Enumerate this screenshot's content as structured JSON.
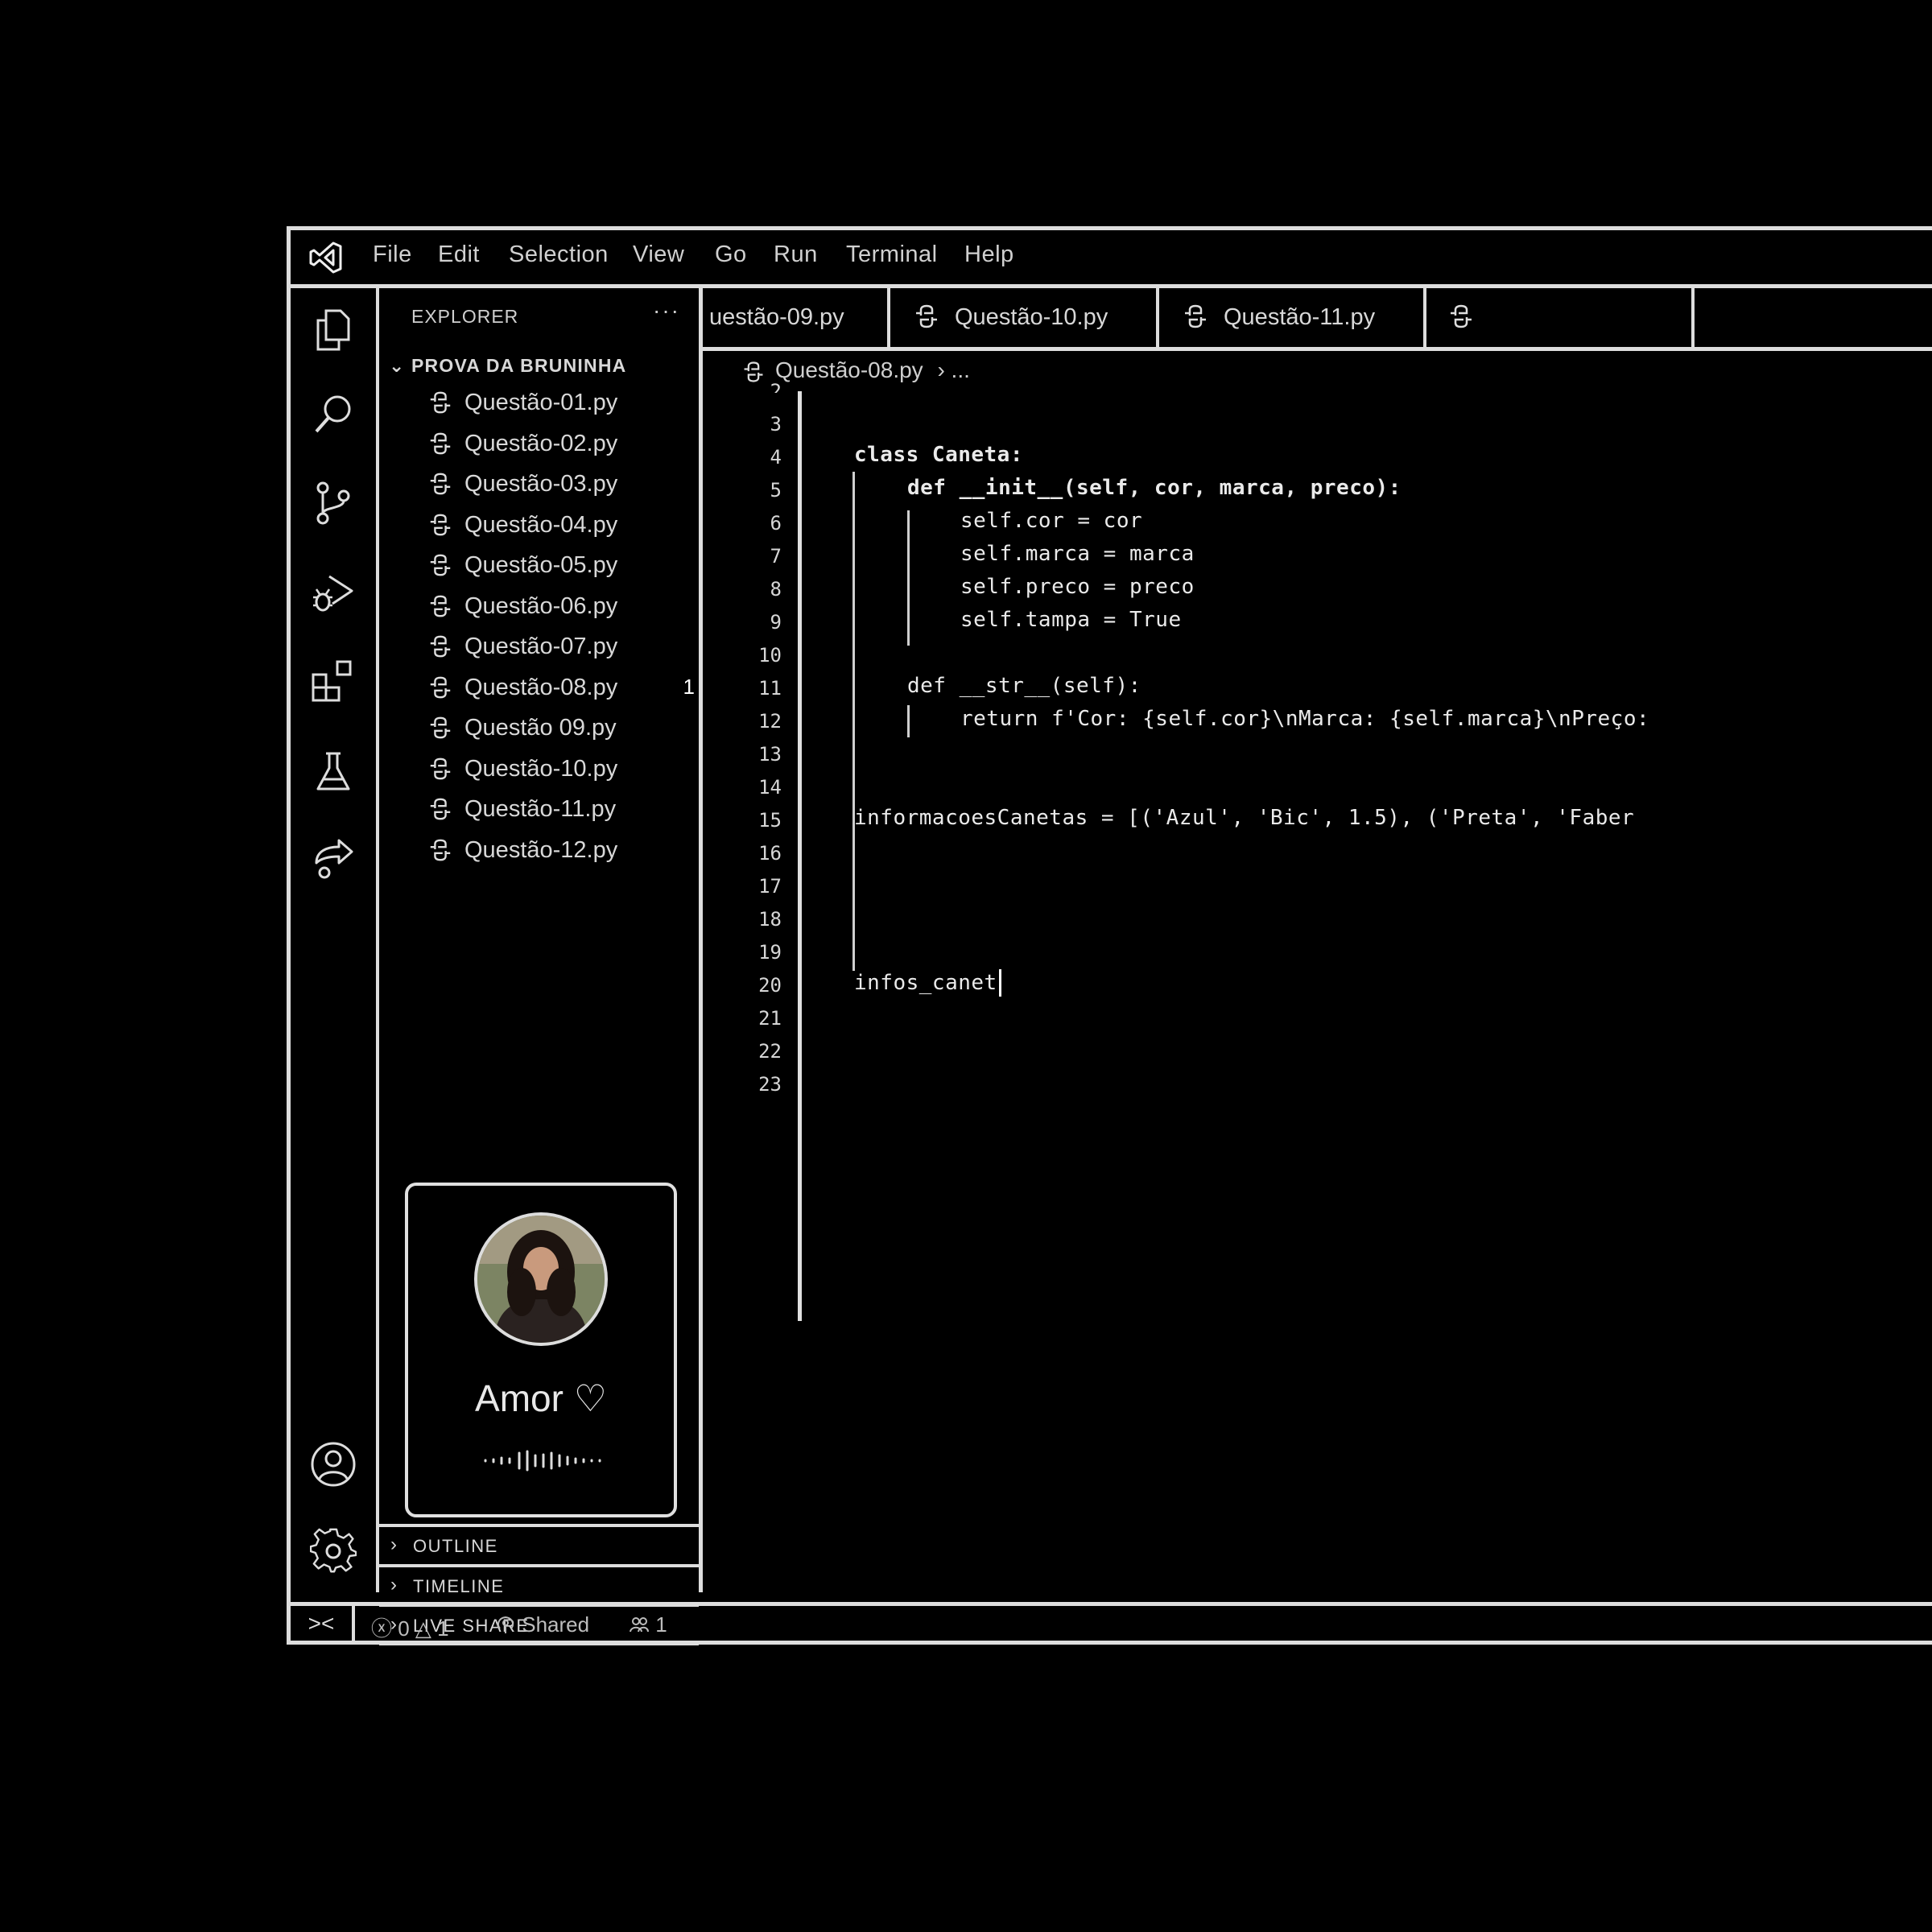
{
  "menu": [
    "File",
    "Edit",
    "Selection",
    "View",
    "Go",
    "Run",
    "Terminal",
    "Help"
  ],
  "activity_icons": [
    "explorer-icon",
    "search-icon",
    "source-control-icon",
    "run-debug-icon",
    "extensions-icon",
    "testing-icon",
    "live-share-icon",
    "account-icon",
    "gear-icon"
  ],
  "sidebar": {
    "title": "EXPLORER",
    "more": "···",
    "folder": "PROVA DA BRUNINHA",
    "files": [
      {
        "name": "Questão-01.py",
        "badge": ""
      },
      {
        "name": "Questão-02.py",
        "badge": ""
      },
      {
        "name": "Questão-03.py",
        "badge": ""
      },
      {
        "name": "Questão-04.py",
        "badge": ""
      },
      {
        "name": "Questão-05.py",
        "badge": ""
      },
      {
        "name": "Questão-06.py",
        "badge": ""
      },
      {
        "name": "Questão-07.py",
        "badge": ""
      },
      {
        "name": "Questão-08.py",
        "badge": "1"
      },
      {
        "name": "Questão 09.py",
        "badge": ""
      },
      {
        "name": "Questão-10.py",
        "badge": ""
      },
      {
        "name": "Questão-11.py",
        "badge": ""
      },
      {
        "name": "Questão-12.py",
        "badge": ""
      }
    ],
    "profile": {
      "name": "Amor ♡"
    },
    "panels": [
      "OUTLINE",
      "TIMELINE",
      "LIVE SHARE"
    ]
  },
  "tabs": [
    "uestão-09.py",
    "Questão-10.py",
    "Questão-11.py",
    ""
  ],
  "breadcrumb": {
    "file": "Questão-08.py",
    "rest": "› ..."
  },
  "line_numbers": [
    "2",
    "3",
    "4",
    "5",
    "6",
    "7",
    "8",
    "9",
    "10",
    "11",
    "12",
    "13",
    "14",
    "15",
    "16",
    "17",
    "18",
    "19",
    "20",
    "21",
    "22",
    "23"
  ],
  "code": {
    "l4": "class Caneta:",
    "l5": "def __init__(self, cor, marca, preco):",
    "l6": "self.cor = cor",
    "l7": "self.marca = marca",
    "l8": "self.preco = preco",
    "l9": "self.tampa = True",
    "l11": "def __str__(self):",
    "l12": "return f'Cor: {self.cor}\\nMarca: {self.marca}\\nPreço:",
    "l15": "informacoesCanetas = [('Azul', 'Bic', 1.5), ('Preta', 'Faber",
    "l20": "infos_canet"
  },
  "status": {
    "remote": "><",
    "problems": "ⓧ 0 △ 1",
    "shared": "Shared",
    "participants": "1"
  }
}
